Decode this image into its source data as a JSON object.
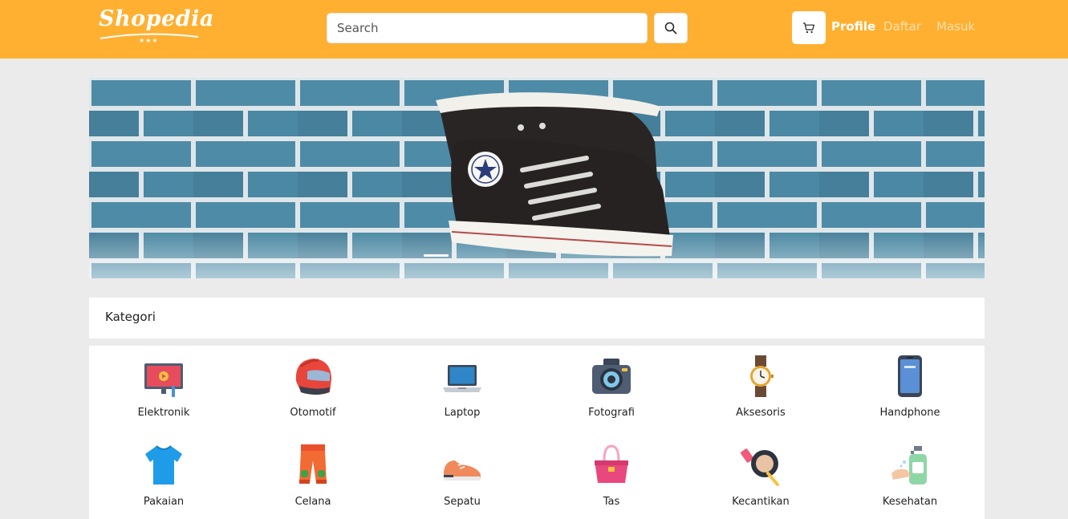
{
  "brand": {
    "name": "Shopedia",
    "stars": "★★★"
  },
  "search": {
    "placeholder": "Search"
  },
  "nav": {
    "profile": "Profile",
    "daftar": "Daftar",
    "masuk": "Masuk"
  },
  "kategori": {
    "title": "Kategori"
  },
  "categories": [
    {
      "label": "Elektronik",
      "icon": "tv-icon"
    },
    {
      "label": "Otomotif",
      "icon": "helmet-icon"
    },
    {
      "label": "Laptop",
      "icon": "laptop-icon"
    },
    {
      "label": "Fotografi",
      "icon": "camera-icon"
    },
    {
      "label": "Aksesoris",
      "icon": "watch-icon"
    },
    {
      "label": "Handphone",
      "icon": "phone-icon"
    },
    {
      "label": "Pakaian",
      "icon": "tshirt-icon"
    },
    {
      "label": "Celana",
      "icon": "pants-icon"
    },
    {
      "label": "Sepatu",
      "icon": "shoe-icon"
    },
    {
      "label": "Tas",
      "icon": "bag-icon"
    },
    {
      "label": "Kecantikan",
      "icon": "makeup-icon"
    },
    {
      "label": "Kesehatan",
      "icon": "sanitizer-icon"
    }
  ],
  "colors": {
    "navbar": "#ffb031",
    "background": "#ebebeb",
    "brick": "#4d8aa4"
  }
}
